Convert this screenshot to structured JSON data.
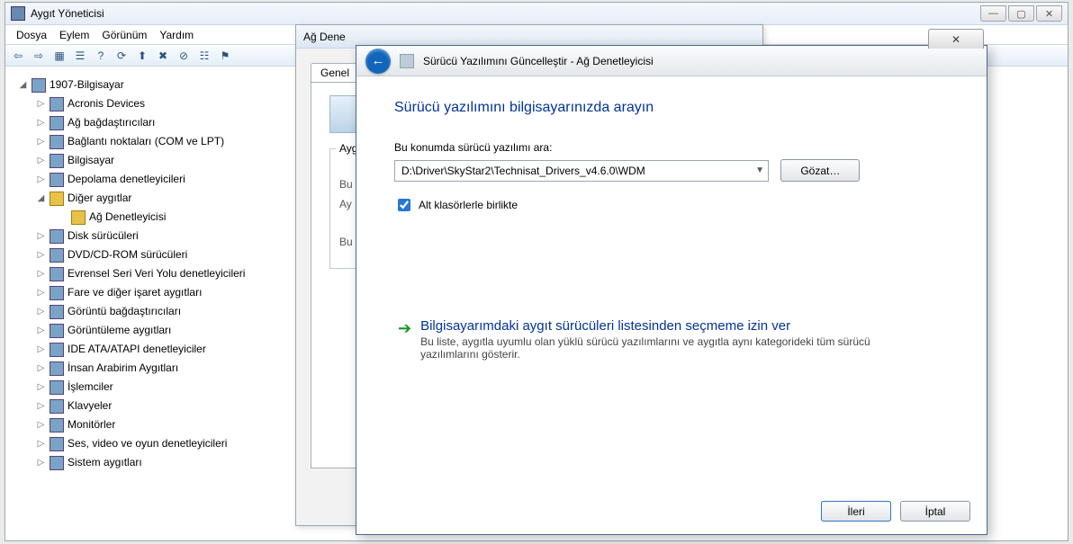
{
  "dm": {
    "title": "Aygıt Yöneticisi",
    "menu": {
      "file": "Dosya",
      "action": "Eylem",
      "view": "Görünüm",
      "help": "Yardım"
    },
    "root": "1907-Bilgisayar",
    "nodes": {
      "acronis": "Acronis Devices",
      "net": "Ağ bağdaştırıcıları",
      "ports": "Bağlantı noktaları (COM ve LPT)",
      "computer": "Bilgisayar",
      "storage": "Depolama denetleyicileri",
      "other": "Diğer aygıtlar",
      "netctrl": "Ağ Denetleyicisi",
      "disk": "Disk sürücüleri",
      "dvd": "DVD/CD-ROM sürücüleri",
      "usb": "Evrensel Seri Veri Yolu denetleyicileri",
      "mouse": "Fare ve diğer işaret aygıtları",
      "display": "Görüntü bağdaştırıcıları",
      "imaging": "Görüntüleme aygıtları",
      "ide": "IDE ATA/ATAPI denetleyiciler",
      "hid": "İnsan Arabirim Aygıtları",
      "cpu": "İşlemciler",
      "kb": "Klavyeler",
      "mon": "Monitörler",
      "sound": "Ses, video ve oyun denetleyicileri",
      "sys": "Sistem aygıtları"
    }
  },
  "netdlg": {
    "title": "Ağ Dene",
    "tab_general": "Genel",
    "group_label": "Ayg",
    "l1": "Bu",
    "l2": "Ay",
    "l3": "Bu"
  },
  "wizard": {
    "title": "Sürücü Yazılımını Güncelleştir - Ağ Denetleyicisi",
    "heading": "Sürücü yazılımını bilgisayarınızda arayın",
    "path_label": "Bu konumda sürücü yazılımı ara:",
    "path_value": "D:\\Driver\\SkyStar2\\Technisat_Drivers_v4.6.0\\WDM",
    "browse": "Gözat…",
    "subfolders": "Alt klasörlerle birlikte",
    "opt_title": "Bilgisayarımdaki aygıt sürücüleri listesinden seçmeme izin ver",
    "opt_desc": "Bu liste, aygıtla uyumlu olan yüklü sürücü yazılımlarını ve aygıtla aynı kategorideki tüm sürücü yazılımlarını gösterir.",
    "next": "İleri",
    "cancel": "İptal",
    "close_glyph": "✕"
  }
}
